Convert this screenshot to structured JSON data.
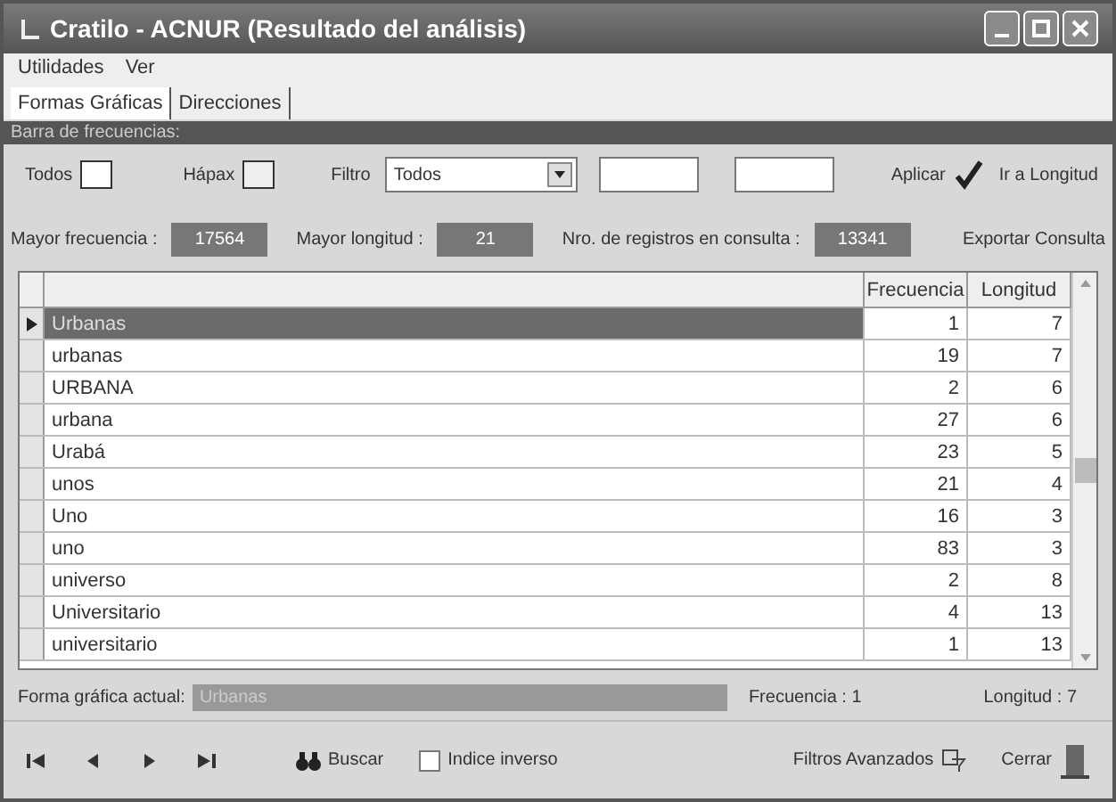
{
  "window": {
    "title": "Cratilo - ACNUR (Resultado del análisis)"
  },
  "menu": [
    "Utilidades",
    "Ver"
  ],
  "tabs": [
    {
      "label": "Formas Gráficas",
      "selected": true
    },
    {
      "label": "Direcciones",
      "selected": false
    }
  ],
  "panel_title": "Barra de frecuencias:",
  "toolbar": {
    "todos": "Todos",
    "hapax": "Hápax",
    "filter_label": "Filtro",
    "filter_value": "Todos",
    "apply": "Aplicar",
    "go_length": "Ir a Longitud"
  },
  "stats": [
    {
      "label": "Mayor frecuencia :",
      "value": "17564"
    },
    {
      "label": "Mayor longitud :",
      "value": "21"
    },
    {
      "label": "Nro. de registros en consulta :",
      "value": "13341"
    }
  ],
  "export": "Exportar Consulta",
  "table": {
    "columns": [
      "Frecuencia",
      "Longitud"
    ],
    "rows": [
      {
        "form": "Urbanas",
        "frequency": "1",
        "length": "7",
        "selected": true
      },
      {
        "form": "urbanas",
        "frequency": "19",
        "length": "7",
        "selected": false
      },
      {
        "form": "URBANA",
        "frequency": "2",
        "length": "6",
        "selected": false
      },
      {
        "form": "urbana",
        "frequency": "27",
        "length": "6",
        "selected": false
      },
      {
        "form": "Urabá",
        "frequency": "23",
        "length": "5",
        "selected": false
      },
      {
        "form": "unos",
        "frequency": "21",
        "length": "4",
        "selected": false
      },
      {
        "form": "Uno",
        "frequency": "16",
        "length": "3",
        "selected": false
      },
      {
        "form": "uno",
        "frequency": "83",
        "length": "3",
        "selected": false
      },
      {
        "form": "universo",
        "frequency": "2",
        "length": "8",
        "selected": false
      },
      {
        "form": "Universitario",
        "frequency": "4",
        "length": "13",
        "selected": false
      },
      {
        "form": "universitario",
        "frequency": "1",
        "length": "13",
        "selected": false
      }
    ]
  },
  "current": {
    "label": "Forma gráfica actual:",
    "value": "Urbanas",
    "frequency": "Frecuencia : 1",
    "length": "Longitud : 7"
  },
  "bottom": {
    "search": "Buscar",
    "inverse_label": "Indice inverso",
    "inverse_checked": false,
    "advanced": "Filtros Avanzados",
    "close": "Cerrar"
  }
}
